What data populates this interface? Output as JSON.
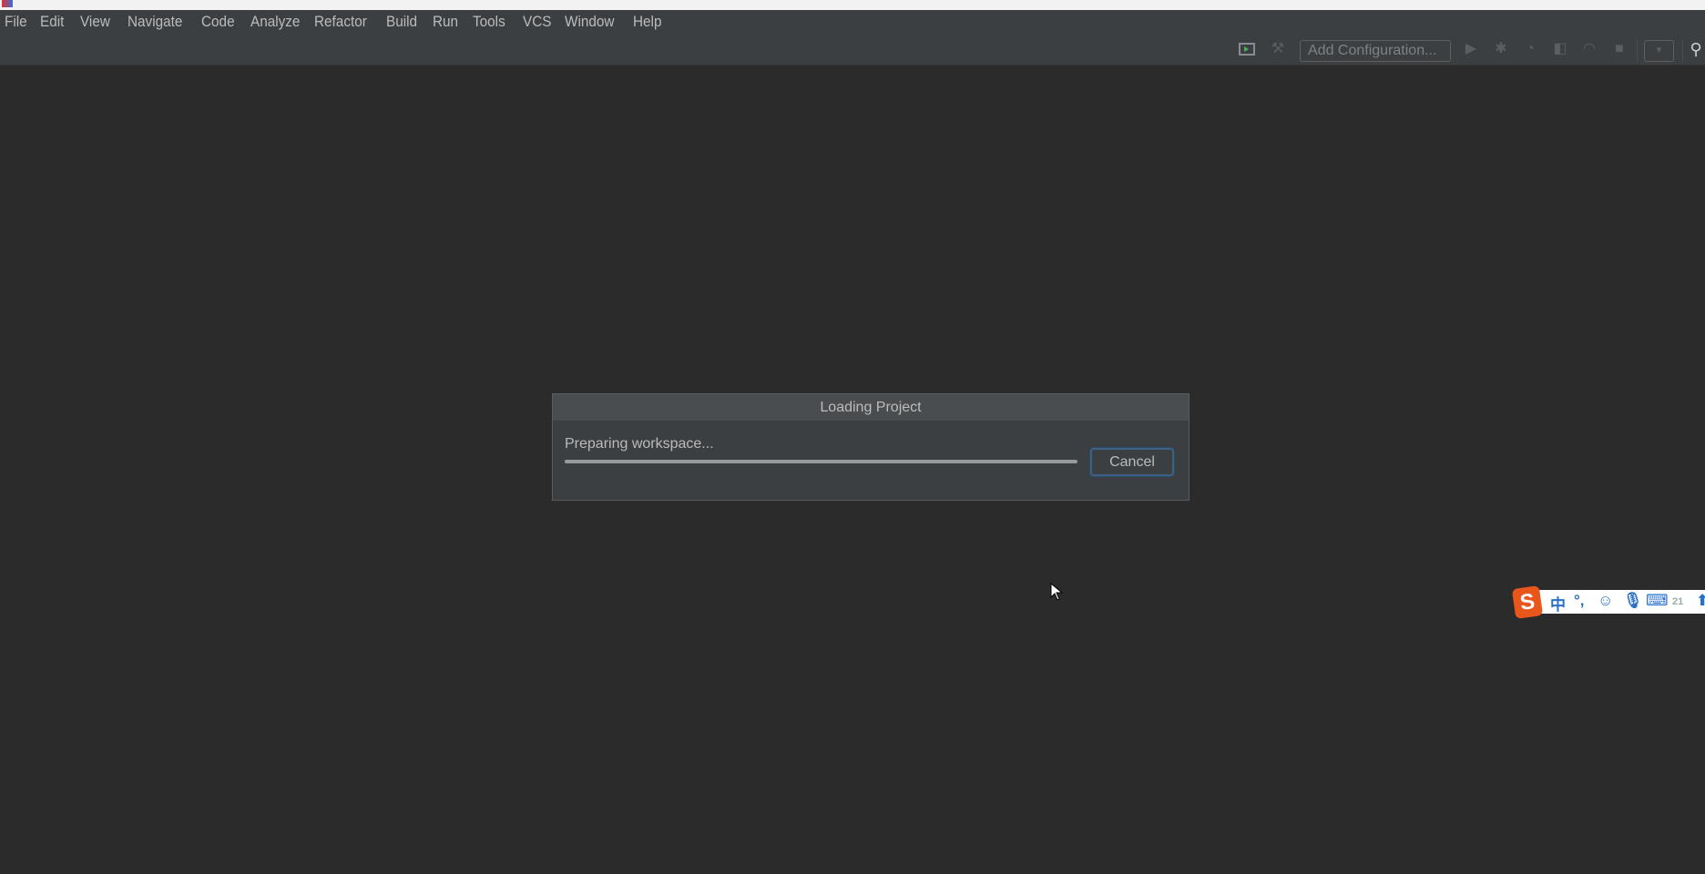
{
  "menubar": {
    "items": [
      "File",
      "Edit",
      "View",
      "Navigate",
      "Code",
      "Analyze",
      "Refactor",
      "Build",
      "Run",
      "Tools",
      "VCS",
      "Window",
      "Help"
    ]
  },
  "toolbar": {
    "add_configuration": "Add Configuration...",
    "icons": [
      "terminal-run-icon",
      "build-hammer-icon",
      "run-icon",
      "debug-icon",
      "coverage-icon",
      "profile-icon",
      "performance-icon",
      "stop-icon",
      "dropdown-icon",
      "search-icon"
    ]
  },
  "dialog": {
    "title": "Loading Project",
    "message": "Preparing workspace...",
    "progress": 1.0,
    "cancel_label": "Cancel"
  },
  "ime": {
    "logo": "S",
    "mode": "中",
    "punct": "°,",
    "count": "21"
  },
  "colors": {
    "background": "#2b2b2b",
    "menubar": "#3c3f41",
    "accent": "#3d6185",
    "ime": "#2a6fc9"
  }
}
